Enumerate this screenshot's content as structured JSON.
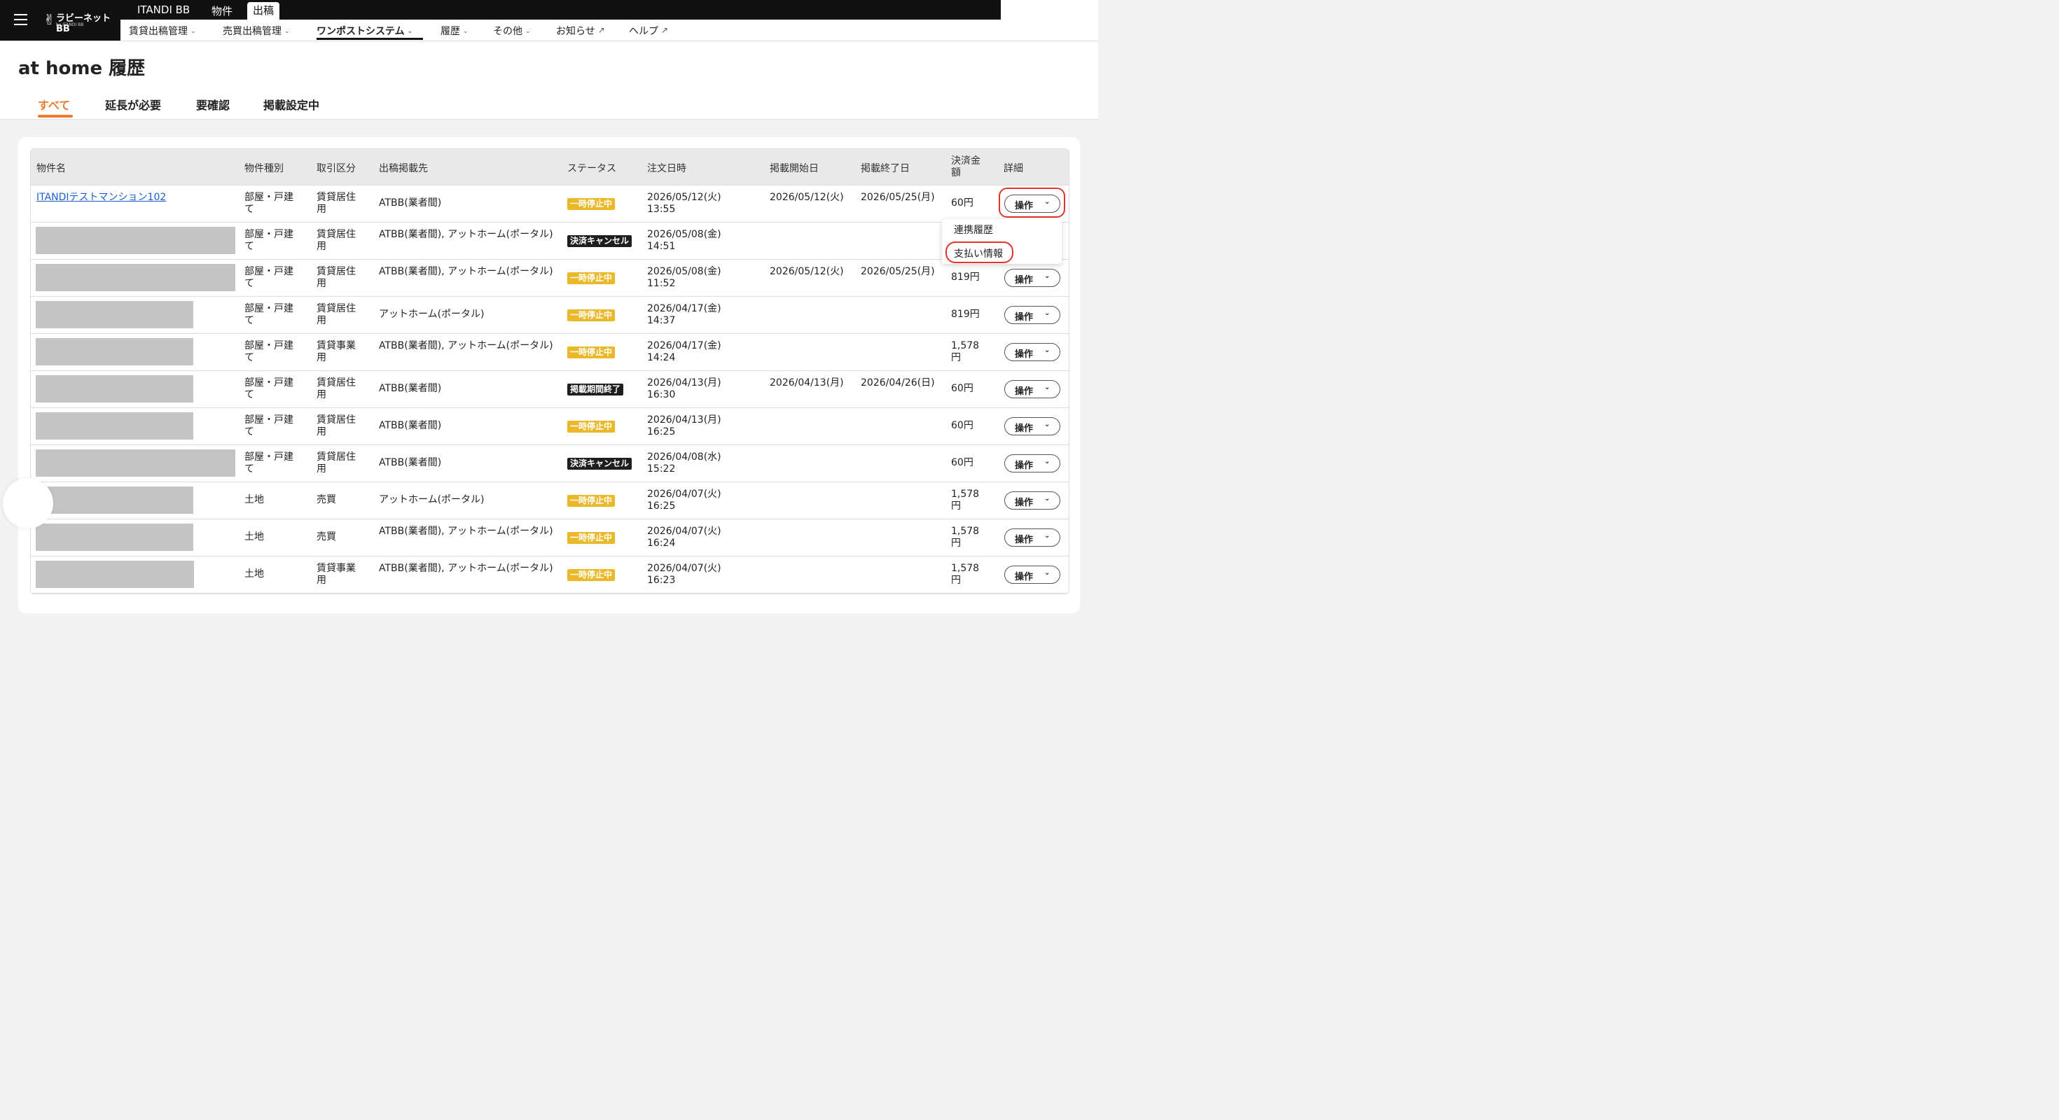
{
  "header": {
    "logo": {
      "name": "ラビーネットBB",
      "sub": "by ITANDI BB"
    },
    "products": [
      "ITANDI BB",
      "物件",
      "出稿"
    ],
    "active_product": "出稿",
    "subnav": [
      {
        "label": "賃貸出稿管理",
        "icon": "chevron-down-icon"
      },
      {
        "label": "売買出稿管理",
        "icon": "chevron-down-icon"
      },
      {
        "label": "ワンポストシステム",
        "icon": "chevron-down-icon",
        "active": true
      },
      {
        "label": "履歴",
        "icon": "chevron-down-icon"
      },
      {
        "label": "その他",
        "icon": "chevron-down-icon"
      },
      {
        "label": "お知らせ",
        "icon": "external-link-icon"
      },
      {
        "label": "ヘルプ",
        "icon": "external-link-icon"
      }
    ]
  },
  "page": {
    "title": "at home 履歴",
    "tabs": [
      "すべて",
      "延長が必要",
      "要確認",
      "掲載設定中"
    ],
    "active_tab": "すべて"
  },
  "table": {
    "headers": [
      "物件名",
      "物件種別",
      "取引区分",
      "出稿掲載先",
      "ステータス",
      "注文日時",
      "掲載開始日",
      "掲載終了日",
      "決済金額",
      "詳細"
    ],
    "rows": [
      {
        "name": "ITANDIテストマンション102",
        "type": "部屋・戸建て",
        "deal": "賃貸居住用",
        "dest": "ATBB(業者間)",
        "status": "一時停止中",
        "status_color": "yellow",
        "ordered": "2026/05/12(火) 13:55",
        "start": "2026/05/12(火)",
        "end": "2026/05/25(月)",
        "amount": "60円",
        "op": "操作"
      },
      {
        "name": "",
        "type": "部屋・戸建て",
        "deal": "賃貸居住用",
        "dest": "ATBB(業者間), アットホーム(ポータル)",
        "status": "決済キャンセル",
        "status_color": "black",
        "ordered": "2026/05/08(金) 14:51",
        "start": "",
        "end": "",
        "amount": "",
        "op": ""
      },
      {
        "name": "",
        "type": "部屋・戸建て",
        "deal": "賃貸居住用",
        "dest": "ATBB(業者間), アットホーム(ポータル)",
        "status": "一時停止中",
        "status_color": "yellow",
        "ordered": "2026/05/08(金) 11:52",
        "start": "2026/05/12(火)",
        "end": "2026/05/25(月)",
        "amount": "819円",
        "op": "操作"
      },
      {
        "name": "",
        "type": "部屋・戸建て",
        "deal": "賃貸居住用",
        "dest": "アットホーム(ポータル)",
        "status": "一時停止中",
        "status_color": "yellow",
        "ordered": "2026/04/17(金) 14:37",
        "start": "",
        "end": "",
        "amount": "819円",
        "op": "操作"
      },
      {
        "name": "",
        "type": "部屋・戸建て",
        "deal": "賃貸事業用",
        "dest": "ATBB(業者間), アットホーム(ポータル)",
        "status": "一時停止中",
        "status_color": "yellow",
        "ordered": "2026/04/17(金) 14:24",
        "start": "",
        "end": "",
        "amount": "1,578円",
        "op": "操作"
      },
      {
        "name": "",
        "type": "部屋・戸建て",
        "deal": "賃貸居住用",
        "dest": "ATBB(業者間)",
        "status": "掲載期間終了",
        "status_color": "black",
        "ordered": "2026/04/13(月) 16:30",
        "start": "2026/04/13(月)",
        "end": "2026/04/26(日)",
        "amount": "60円",
        "op": "操作"
      },
      {
        "name": "",
        "type": "部屋・戸建て",
        "deal": "賃貸居住用",
        "dest": "ATBB(業者間)",
        "status": "一時停止中",
        "status_color": "yellow",
        "ordered": "2026/04/13(月) 16:25",
        "start": "",
        "end": "",
        "amount": "60円",
        "op": "操作"
      },
      {
        "name": "",
        "type": "部屋・戸建て",
        "deal": "賃貸居住用",
        "dest": "ATBB(業者間)",
        "status": "決済キャンセル",
        "status_color": "black",
        "ordered": "2026/04/08(水) 15:22",
        "start": "",
        "end": "",
        "amount": "60円",
        "op": "操作"
      },
      {
        "name": "",
        "type": "土地",
        "deal": "売買",
        "dest": "アットホーム(ポータル)",
        "status": "一時停止中",
        "status_color": "yellow",
        "ordered": "2026/04/07(火) 16:25",
        "start": "",
        "end": "",
        "amount": "1,578円",
        "op": "操作"
      },
      {
        "name": "",
        "type": "土地",
        "deal": "売買",
        "dest": "ATBB(業者間), アットホーム(ポータル)",
        "status": "一時停止中",
        "status_color": "yellow",
        "ordered": "2026/04/07(火) 16:24",
        "start": "",
        "end": "",
        "amount": "1,578円",
        "op": "操作"
      },
      {
        "name": "",
        "type": "土地",
        "deal": "賃貸事業用",
        "dest": "ATBB(業者間), アットホーム(ポータル)",
        "status": "一時停止中",
        "status_color": "yellow",
        "ordered": "2026/04/07(火) 16:23",
        "start": "",
        "end": "",
        "amount": "1,578円",
        "op": "操作"
      }
    ]
  },
  "dropdown": {
    "options": [
      "連携履歴",
      "支払い情報"
    ]
  },
  "colors": {
    "accent": "#f07a32",
    "badge_yellow": "#eab828",
    "badge_black": "#1e1e1e",
    "highlight_ring": "#e5322a",
    "link": "#1d5fd1"
  }
}
